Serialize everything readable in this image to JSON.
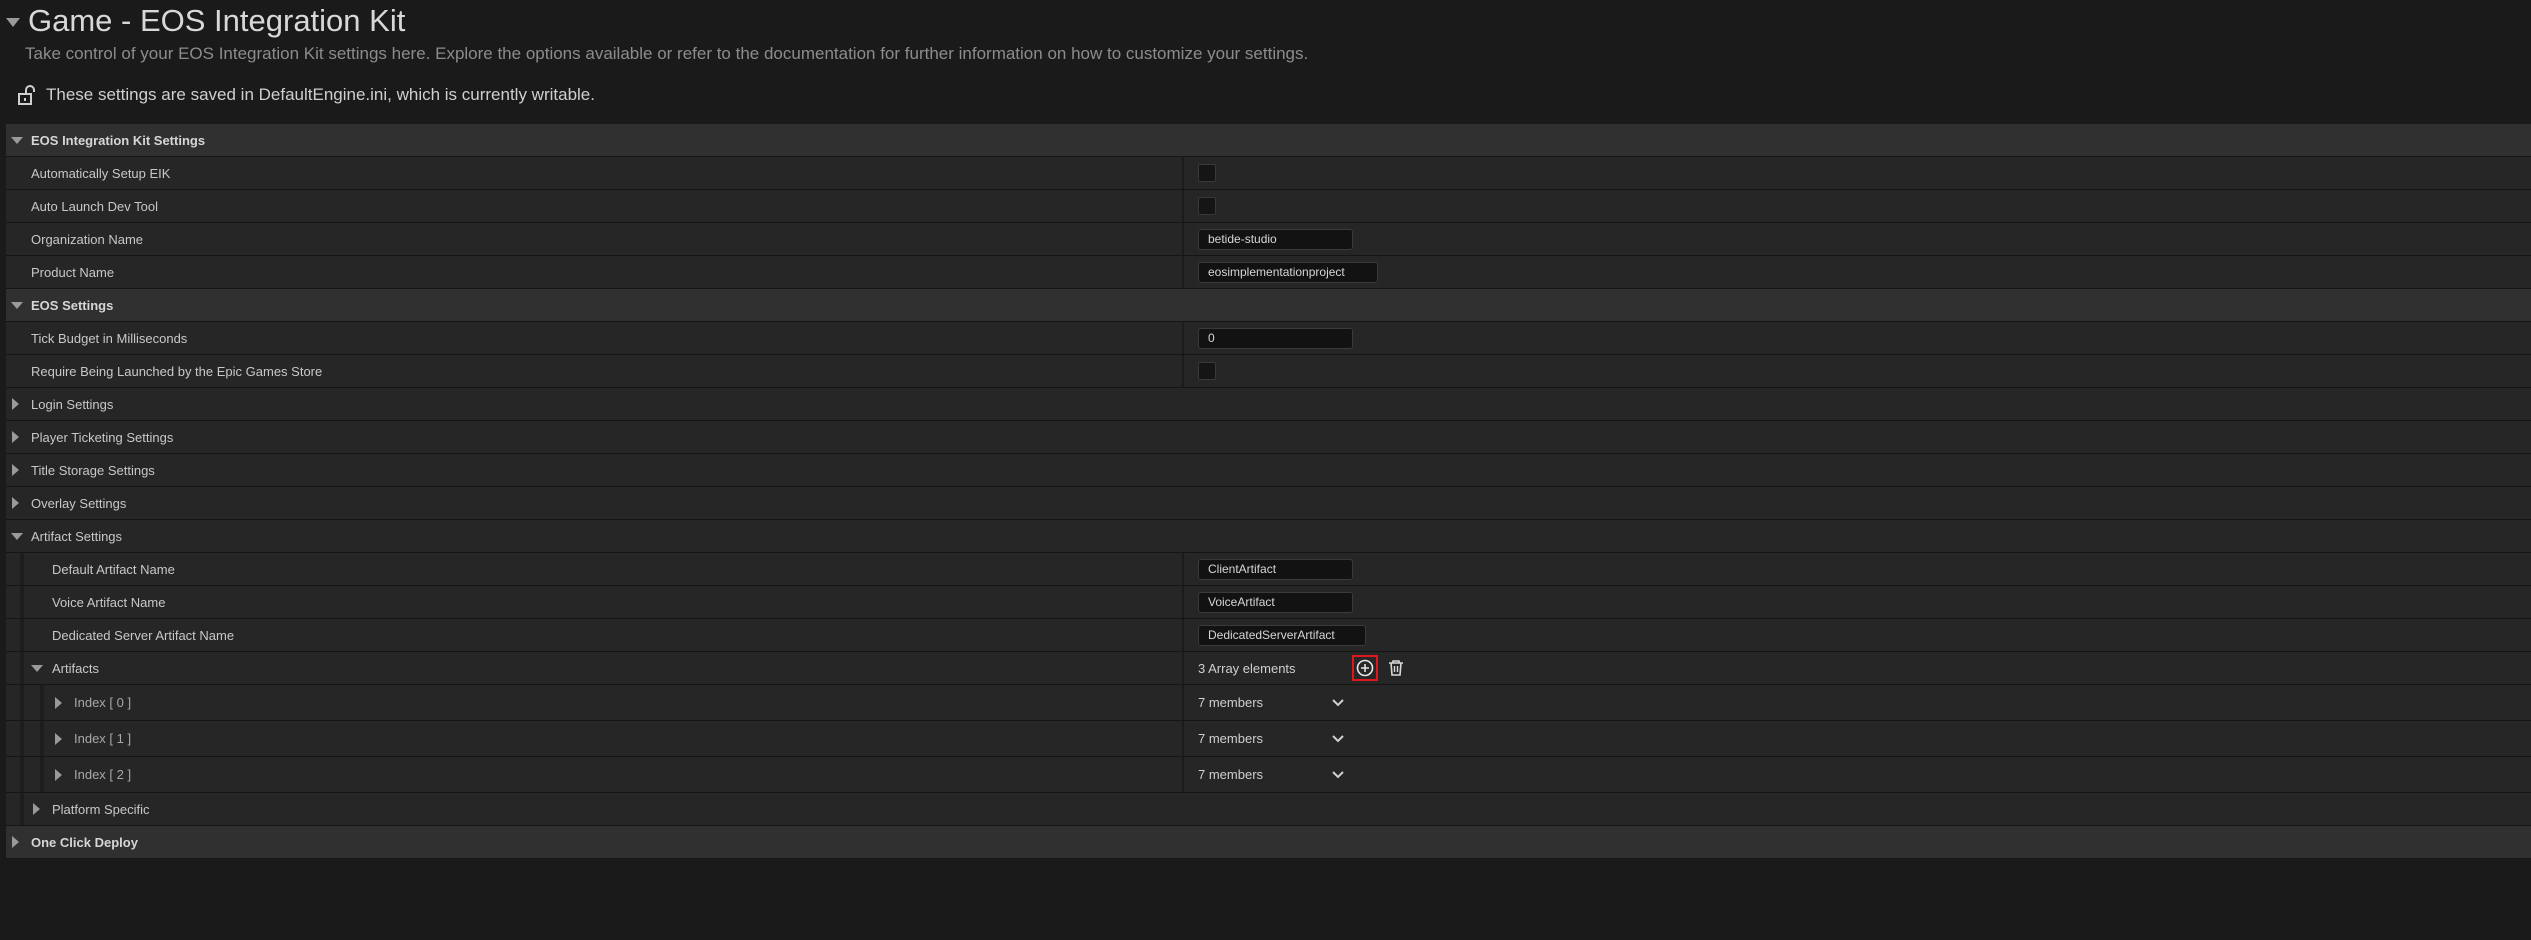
{
  "header": {
    "title": "Game - EOS Integration Kit",
    "subtitle": "Take control of your EOS Integration Kit settings here. Explore the options available or refer to the documentation for further information on how to customize your settings.",
    "config_status": "These settings are saved in DefaultEngine.ini, which is currently writable."
  },
  "sections": {
    "eik": {
      "label": "EOS Integration Kit Settings",
      "auto_setup": "Automatically Setup EIK",
      "auto_launch": "Auto Launch Dev Tool",
      "org_name": "Organization Name",
      "org_name_value": "betide-studio",
      "product_name": "Product Name",
      "product_name_value": "eosimplementationproject"
    },
    "eos": {
      "label": "EOS Settings",
      "tick_budget": "Tick Budget in Milliseconds",
      "tick_budget_value": "0",
      "require_launch": "Require Being Launched by the Epic Games Store"
    },
    "login": "Login Settings",
    "player_ticketing": "Player Ticketing Settings",
    "title_storage": "Title Storage Settings",
    "overlay": "Overlay Settings",
    "artifact": {
      "label": "Artifact Settings",
      "default_name": "Default Artifact Name",
      "default_name_value": "ClientArtifact",
      "voice_name": "Voice Artifact Name",
      "voice_name_value": "VoiceArtifact",
      "server_name": "Dedicated Server Artifact Name",
      "server_name_value": "DedicatedServerArtifact",
      "artifacts": "Artifacts",
      "artifacts_count": "3 Array elements",
      "items": [
        {
          "label": "Index [ 0 ]",
          "members": "7 members"
        },
        {
          "label": "Index [ 1 ]",
          "members": "7 members"
        },
        {
          "label": "Index [ 2 ]",
          "members": "7 members"
        }
      ],
      "platform_specific": "Platform Specific"
    },
    "one_click": "One Click Deploy"
  },
  "icons": {
    "add": "plus-circle-icon",
    "delete": "trash-icon",
    "lock": "unlock-icon"
  },
  "colors": {
    "highlight": "#e0161a"
  }
}
